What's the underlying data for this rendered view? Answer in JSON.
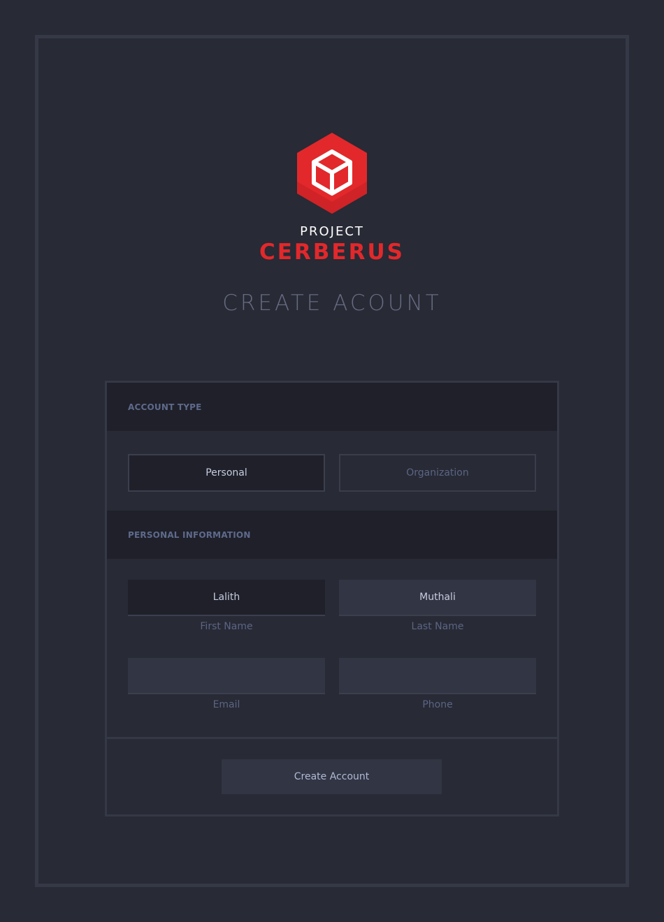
{
  "brand": {
    "line1": "PROJECT",
    "line2": "CERBERUS",
    "accent_color": "#e2282b",
    "logo_icon": "cube-hexagon-icon"
  },
  "page": {
    "title": "CREATE ACOUNT"
  },
  "account_type": {
    "header": "ACCOUNT TYPE",
    "options": [
      "Personal",
      "Organization"
    ],
    "selected": "Personal"
  },
  "personal_info": {
    "header": "PERSONAL INFORMATION",
    "first_name": {
      "value": "Lalith",
      "label": "First Name"
    },
    "last_name": {
      "value": "Muthali",
      "label": "Last Name"
    },
    "email": {
      "value": "",
      "label": "Email"
    },
    "phone": {
      "value": "",
      "label": "Phone"
    }
  },
  "actions": {
    "submit_label": "Create Account"
  }
}
